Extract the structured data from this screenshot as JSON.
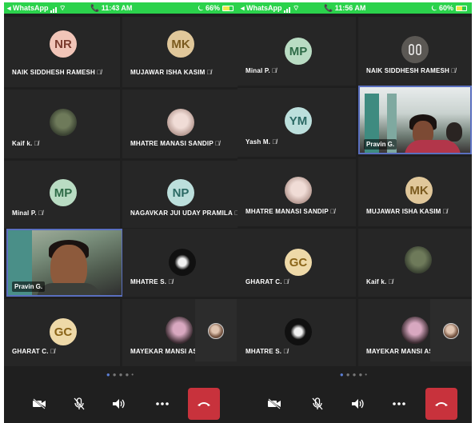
{
  "left": {
    "status": {
      "back": "◂ WhatsApp",
      "time": "11:43 AM",
      "battery": "66%"
    },
    "tiles": [
      {
        "initials": "NR",
        "name": "NAIK  SIDDHESH  RAMESH"
      },
      {
        "initials": "MK",
        "name": "MUJAWAR ISHA KASIM"
      },
      {
        "name": "Kaif k."
      },
      {
        "name": "MHATRE MANASI SANDIP"
      },
      {
        "initials": "MP",
        "name": "Minal P."
      },
      {
        "initials": "NP",
        "name": "NAGAVKAR  JUI  UDAY  PRAMILA"
      },
      {
        "name": "Pravin G."
      },
      {
        "name": "MHATRE S."
      },
      {
        "initials": "GC",
        "name": "GHARAT C."
      },
      {
        "name": "MAYEKAR MANSI AS"
      }
    ]
  },
  "right": {
    "status": {
      "back": "◂ WhatsApp",
      "time": "11:56 AM",
      "battery": "60%"
    },
    "tiles": [
      {
        "initials": "MP",
        "name": "Minal P."
      },
      {
        "name": "NAIK  SIDDHESH  RAMESH"
      },
      {
        "initials": "YM",
        "name": "Yash M."
      },
      {
        "name": "Pravin G."
      },
      {
        "name": "MHATRE MANASI SANDIP"
      },
      {
        "initials": "MK",
        "name": "MUJAWAR ISHA KASIM"
      },
      {
        "initials": "GC",
        "name": "GHARAT C."
      },
      {
        "name": "Kaif k."
      },
      {
        "name": "MHATRE S."
      },
      {
        "name": "MAYEKAR MANSI AS"
      }
    ]
  },
  "colors": {
    "avatar_peach": "#f1c5b8",
    "avatar_peach_text": "#7a3b2e",
    "avatar_tan": "#e0c79a",
    "avatar_tan_text": "#7a5a1e",
    "avatar_mint": "#b9dcc3",
    "avatar_mint_text": "#2e6b47",
    "avatar_teal": "#bcdfdc",
    "avatar_teal_text": "#2b6964",
    "avatar_gold": "#eed9a8",
    "avatar_gold_text": "#8a6418",
    "hangup": "#c8323c",
    "active_border": "#5a6fbf"
  },
  "icons": [
    "video-off-icon",
    "mic-off-icon",
    "speaker-icon",
    "more-icon",
    "hangup-icon",
    "wifi-icon",
    "battery-icon",
    "mic-muted-icon"
  ]
}
